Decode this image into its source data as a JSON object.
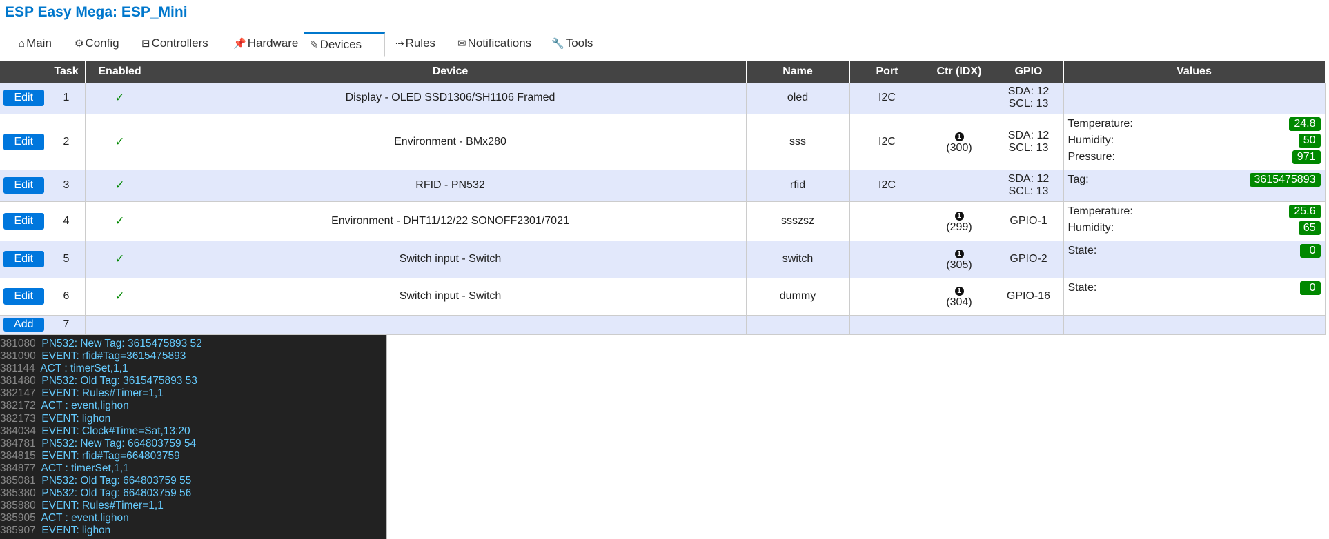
{
  "title": "ESP Easy Mega: ESP_Mini",
  "tabs": [
    {
      "icon": "⌂",
      "label": "Main"
    },
    {
      "icon": "⚙",
      "label": "Config"
    },
    {
      "icon": "⊟",
      "label": "Controllers"
    },
    {
      "icon": "📌",
      "label": "Hardware"
    },
    {
      "icon": "✎",
      "label": "Devices"
    },
    {
      "icon": "⇢",
      "label": "Rules"
    },
    {
      "icon": "✉",
      "label": "Notifications"
    },
    {
      "icon": "🔧",
      "label": "Tools"
    }
  ],
  "active_tab": "Devices",
  "table": {
    "headers": [
      "",
      "Task",
      "Enabled",
      "Device",
      "Name",
      "Port",
      "Ctr (IDX)",
      "GPIO",
      "Values"
    ],
    "edit_label": "Edit",
    "add_label": "Add",
    "enabled_mark": "✓",
    "ctr_dot": "1",
    "rows": [
      {
        "task": "1",
        "device": "Display - OLED SSD1306/SH1106 Framed",
        "name": "oled",
        "port": "I2C",
        "idx": "",
        "gpio1": "SDA: 12",
        "gpio2": "SCL: 13",
        "values": []
      },
      {
        "task": "2",
        "device": "Environment - BMx280",
        "name": "sss",
        "port": "I2C",
        "idx": "(300)",
        "gpio1": "SDA: 12",
        "gpio2": "SCL: 13",
        "values": [
          {
            "label": "Temperature:",
            "value": "24.8"
          },
          {
            "label": "Humidity:",
            "value": "50"
          },
          {
            "label": "Pressure:",
            "value": "971"
          }
        ]
      },
      {
        "task": "3",
        "device": "RFID - PN532",
        "name": "rfid",
        "port": "I2C",
        "idx": "",
        "gpio1": "SDA: 12",
        "gpio2": "SCL: 13",
        "values": [
          {
            "label": "Tag:",
            "value": "3615475893"
          }
        ]
      },
      {
        "task": "4",
        "device": "Environment - DHT11/12/22 SONOFF2301/7021",
        "name": "ssszsz",
        "port": "",
        "idx": "(299)",
        "gpio1": "GPIO-1",
        "gpio2": "",
        "values": [
          {
            "label": "Temperature:",
            "value": "25.6"
          },
          {
            "label": "Humidity:",
            "value": "65"
          }
        ]
      },
      {
        "task": "5",
        "device": "Switch input - Switch",
        "name": "switch",
        "port": "",
        "idx": "(305)",
        "gpio1": "GPIO-2",
        "gpio2": "",
        "values": [
          {
            "label": "State:",
            "value": "0"
          }
        ]
      },
      {
        "task": "6",
        "device": "Switch input - Switch",
        "name": "dummy",
        "port": "",
        "idx": "(304)",
        "gpio1": "GPIO-16",
        "gpio2": "",
        "values": [
          {
            "label": "State:",
            "value": "0"
          }
        ]
      }
    ],
    "add_row_task": "7"
  },
  "log": [
    {
      "ts": "381080",
      "msg": "PN532: New Tag: 3615475893 52"
    },
    {
      "ts": "381090",
      "msg": "EVENT: rfid#Tag=3615475893"
    },
    {
      "ts": "381144",
      "msg": "ACT : timerSet,1,1"
    },
    {
      "ts": "381480",
      "msg": "PN532: Old Tag: 3615475893 53"
    },
    {
      "ts": "382147",
      "msg": "EVENT: Rules#Timer=1,1"
    },
    {
      "ts": "382172",
      "msg": "ACT : event,lighon"
    },
    {
      "ts": "382173",
      "msg": "EVENT: lighon"
    },
    {
      "ts": "384034",
      "msg": "EVENT: Clock#Time=Sat,13:20"
    },
    {
      "ts": "384781",
      "msg": "PN532: New Tag: 664803759 54"
    },
    {
      "ts": "384815",
      "msg": "EVENT: rfid#Tag=664803759"
    },
    {
      "ts": "384877",
      "msg": "ACT : timerSet,1,1"
    },
    {
      "ts": "385081",
      "msg": "PN532: Old Tag: 664803759 55"
    },
    {
      "ts": "385380",
      "msg": "PN532: Old Tag: 664803759 56"
    },
    {
      "ts": "385880",
      "msg": "EVENT: Rules#Timer=1,1"
    },
    {
      "ts": "385905",
      "msg": "ACT : event,lighon"
    },
    {
      "ts": "385907",
      "msg": "EVENT: lighon"
    }
  ]
}
